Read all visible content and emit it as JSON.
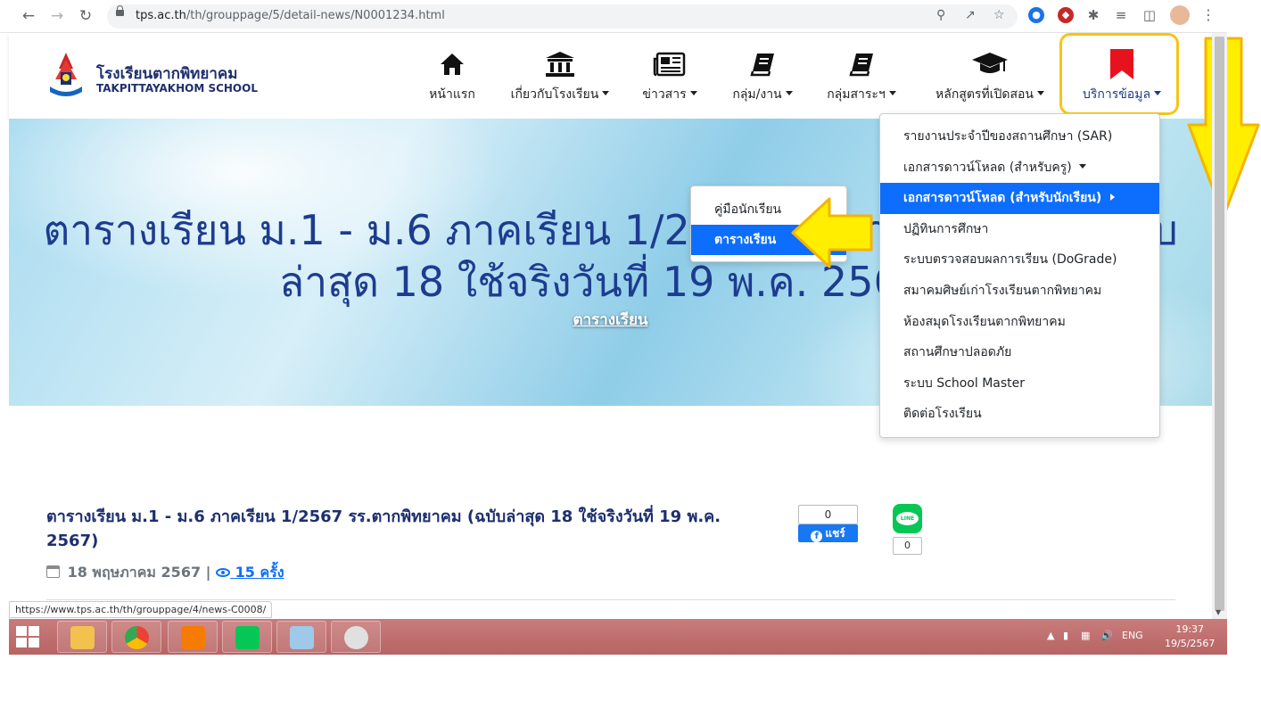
{
  "browser": {
    "url_host": "tps.ac.th",
    "url_path": "/th/grouppage/5/detail-news/N0001234.html"
  },
  "header": {
    "logo_th": "โรงเรียนตากพิทยาคม",
    "logo_en": "TAKPITTAYAKHOM SCHOOL",
    "menu": [
      {
        "label": "หน้าแรก",
        "icon": "home-icon"
      },
      {
        "label": "เกี่ยวกับโรงเรียน",
        "icon": "bank-icon"
      },
      {
        "label": "ข่าวสาร",
        "icon": "newspaper-icon"
      },
      {
        "label": "กลุ่ม/งาน",
        "icon": "book-icon"
      },
      {
        "label": "กลุ่มสาระฯ",
        "icon": "book-icon"
      },
      {
        "label": "หลักสูตรที่เปิดสอน",
        "icon": "graduation-cap-icon"
      },
      {
        "label": "บริการข้อมูล",
        "icon": "bookmark-icon"
      }
    ]
  },
  "hero": {
    "title": "ตารางเรียน ม.1 - ม.6 ภาคเรียน 1/2567 รร.ตากพิทยาคม (ฉบับ\nล่าสุด 18 ใช้จริงวันที่ 19 พ.ค. 2567)",
    "category": "ตารางเรียน"
  },
  "dropdown": {
    "items": [
      "รายงานประจำปีของสถานศึกษา (SAR)",
      "เอกสารดาวน์โหลด (สำหรับครู)",
      "เอกสารดาวน์โหลด (สำหรับนักเรียน)",
      "ปฏิทินการศึกษา",
      "ระบบตรวจสอบผลการเรียน (DoGrade)",
      "สมาคมศิษย์เก่าโรงเรียนตากพิทยาคม",
      "ห้องสมุดโรงเรียนตากพิทยาคม",
      "สถานศึกษาปลอดภัย",
      "ระบบ School Master",
      "ติดต่อโรงเรียน"
    ]
  },
  "submenu": {
    "items": [
      "คู่มือนักเรียน",
      "ตารางเรียน"
    ]
  },
  "article": {
    "title": "ตารางเรียน ม.1 - ม.6 ภาคเรียน 1/2567 รร.ตากพิทยาคม (ฉบับล่าสุด 18 ใช้จริงวันที่ 19 พ.ค. 2567)",
    "date": "18 พฤษภาคม 2567",
    "separator": "|",
    "views": "15 ครั้ง",
    "fb_count": "0",
    "fb_share_label": "แชร์",
    "line_label": "LINE",
    "line_count": "0"
  },
  "status_url": "https://www.tps.ac.th/th/grouppage/4/news-C0008/",
  "taskbar": {
    "lang": "ENG",
    "time": "19:37",
    "date": "19/5/2567"
  },
  "colors": {
    "accent_blue": "#0d6efd",
    "brand_navy": "#1e2f6e",
    "highlight_yellow": "#f5c518",
    "arrow_yellow": "#ffee00"
  }
}
